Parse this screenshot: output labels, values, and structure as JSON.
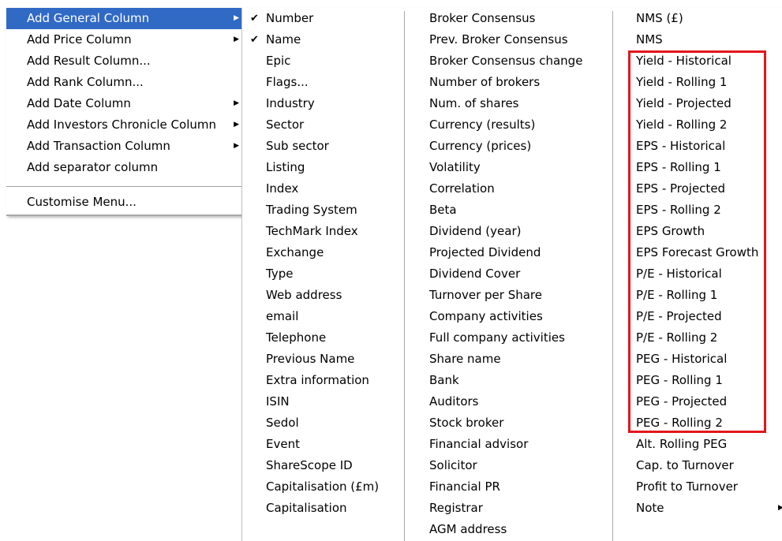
{
  "main_menu": {
    "items": [
      {
        "label": "Add General Column",
        "submenu": true
      },
      {
        "label": "Add Price Column",
        "submenu": true
      },
      {
        "label": "Add Result Column...",
        "submenu": false
      },
      {
        "label": "Add Rank Column...",
        "submenu": false
      },
      {
        "label": "Add Date Column",
        "submenu": true
      },
      {
        "label": "Add Investors Chronicle Column",
        "submenu": true
      },
      {
        "label": "Add Transaction Column",
        "submenu": true
      },
      {
        "label": "Add separator column",
        "submenu": false
      }
    ],
    "footer_item": "Customise Menu...",
    "selected_index": 0,
    "submenu_arrow_icon": "right-triangle-icon"
  },
  "sub_menu": {
    "columns": [
      [
        "Number",
        "Name",
        "Epic",
        "Flags...",
        "Industry",
        "Sector",
        "Sub sector",
        "Listing",
        "Index",
        "Trading System",
        "TechMark Index",
        "Exchange",
        "Type",
        "Web address",
        "email",
        "Telephone",
        "Previous Name",
        "Extra information",
        "ISIN",
        "Sedol",
        "Event",
        "ShareScope ID",
        "Capitalisation (£m)",
        "Capitalisation"
      ],
      [
        "Broker Consensus",
        "Prev. Broker Consensus",
        "Broker Consensus change",
        "Number of brokers",
        "Num. of shares",
        "Currency (results)",
        "Currency (prices)",
        "Volatility",
        "Correlation",
        "Beta",
        "Dividend (year)",
        "Projected Dividend",
        "Dividend Cover",
        "Turnover per Share",
        "Company activities",
        "Full company activities",
        "Share name",
        "Bank",
        "Auditors",
        "Stock broker",
        "Financial advisor",
        "Solicitor",
        "Financial PR",
        "Registrar",
        "AGM address"
      ],
      [
        "NMS (£)",
        "NMS",
        "Yield - Historical",
        "Yield - Rolling 1",
        "Yield - Projected",
        "Yield - Rolling 2",
        "EPS - Historical",
        "EPS - Rolling 1",
        "EPS - Projected",
        "EPS - Rolling 2",
        "EPS Growth",
        "EPS Forecast Growth",
        "P/E - Historical",
        "P/E - Rolling 1",
        "P/E - Projected",
        "P/E - Rolling 2",
        "PEG - Historical",
        "PEG - Rolling 1",
        "PEG - Projected",
        "PEG - Rolling 2",
        "Alt. Rolling PEG",
        "Cap. to Turnover",
        "Profit to Turnover",
        "Note"
      ]
    ],
    "checked_items": [
      "Number",
      "Name"
    ],
    "check_icon": "checkmark-icon",
    "note_has_submenu": true
  },
  "colors": {
    "selected_bg": "#316ac5",
    "selected_text": "#ffffff",
    "highlight_border": "#e4151c"
  }
}
